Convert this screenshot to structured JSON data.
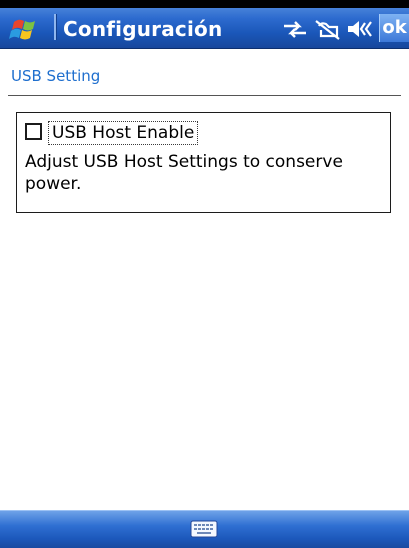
{
  "titlebar": {
    "title": "Configuración",
    "ok_label": "ok",
    "start_icon": "windows-flag-icon",
    "status_icons": [
      "connectivity-icon",
      "phone-off-icon",
      "volume-icon"
    ]
  },
  "page": {
    "heading": "USB Setting"
  },
  "setting": {
    "checkbox_label": "USB Host Enable",
    "checked": false,
    "description": "Adjust USB Host Settings to conserve power."
  },
  "bottombar": {
    "keyboard_icon": "keyboard-icon"
  },
  "colors": {
    "titlebar": "#2d6bcf",
    "heading_text": "#1f6fce",
    "bottombar": "#2f6fd2"
  }
}
